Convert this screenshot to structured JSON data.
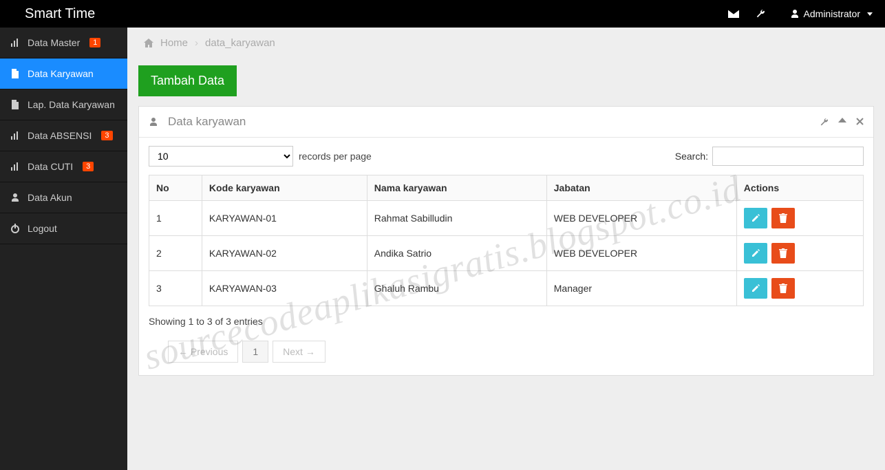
{
  "brand": "Smart Time",
  "topbar": {
    "user_label": "Administrator"
  },
  "sidebar": {
    "items": [
      {
        "label": "Data Master",
        "badge": "1",
        "icon": "bar-chart"
      },
      {
        "label": "Data Karyawan",
        "icon": "file",
        "active": true
      },
      {
        "label": "Lap. Data Karyawan",
        "icon": "file"
      },
      {
        "label": "Data ABSENSI",
        "badge": "3",
        "icon": "bar-chart"
      },
      {
        "label": "Data CUTI",
        "badge": "3",
        "icon": "bar-chart"
      },
      {
        "label": "Data Akun",
        "icon": "user"
      },
      {
        "label": "Logout",
        "icon": "power"
      }
    ]
  },
  "breadcrumb": {
    "home": "Home",
    "current": "data_karyawan"
  },
  "add_button": "Tambah Data",
  "panel": {
    "title": "Data karyawan",
    "length_value": "10",
    "records_label": "records per page",
    "search_label": "Search:",
    "search_value": "",
    "columns": [
      "No",
      "Kode karyawan",
      "Nama karyawan",
      "Jabatan",
      "Actions"
    ],
    "rows": [
      {
        "no": "1",
        "kode": "KARYAWAN-01",
        "nama": "Rahmat Sabilludin",
        "jabatan": "WEB DEVELOPER"
      },
      {
        "no": "2",
        "kode": "KARYAWAN-02",
        "nama": "Andika Satrio",
        "jabatan": "WEB DEVELOPER"
      },
      {
        "no": "3",
        "kode": "KARYAWAN-03",
        "nama": "Ghaluh Rambu",
        "jabatan": "Manager"
      }
    ],
    "info": "Showing 1 to 3 of 3 entries",
    "prev": "← Previous",
    "page": "1",
    "next": "Next →"
  },
  "watermark": "sourcecodeaplikasigratis.blogspot.co.id"
}
